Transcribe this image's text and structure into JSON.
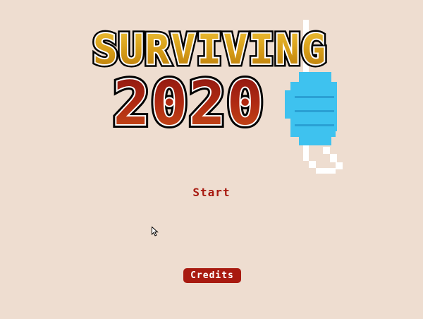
{
  "title": {
    "line1": "SURVIVING",
    "line2": "2020",
    "line1_color": "#d49a16",
    "line2_color": "#b02a12"
  },
  "menu": {
    "start_label": "Start",
    "credits_label": "Credits"
  },
  "colors": {
    "background": "#eeddd0",
    "accent": "#a81a10",
    "button_text": "#ffffff",
    "mask": "#3ec2ef",
    "mask_strap": "#ffffff"
  },
  "icons": {
    "mask": "face-mask-icon",
    "cursor": "mouse-cursor-icon"
  }
}
